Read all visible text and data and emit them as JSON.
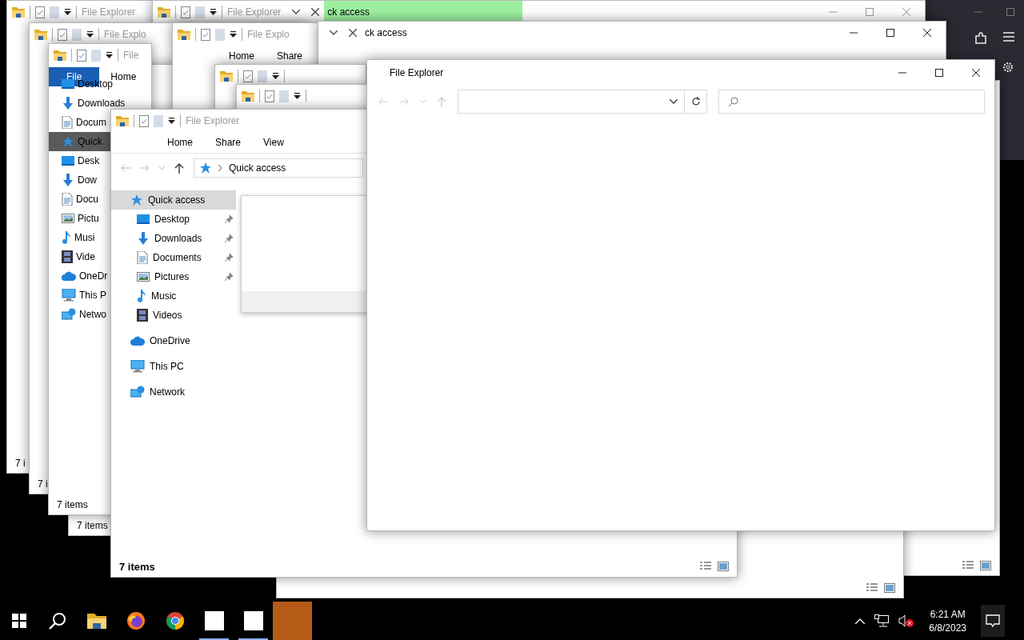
{
  "desktop_windows": [
    {
      "kind": "browser"
    },
    {
      "kind": "explorer",
      "title": "File Explorer",
      "status": "7 i"
    },
    {
      "kind": "blank"
    },
    {
      "kind": "explorer",
      "title": "File Explorer",
      "tab_label": "ck access",
      "highlighted": true
    },
    {
      "kind": "explorer",
      "title": "File Explo",
      "status": "7 i"
    },
    {
      "kind": "blank"
    },
    {
      "kind": "frame",
      "status": "7 items"
    },
    {
      "kind": "explorer",
      "title": "File Explo",
      "ribbon": [
        {
          "label": "Home",
          "selected": false
        },
        {
          "label": "Share",
          "selected": false
        }
      ]
    },
    {
      "kind": "tab",
      "tab_label": "ck access",
      "highlighted": false
    },
    {
      "kind": "explorer",
      "title": "File",
      "ribbon": [
        {
          "label": "File",
          "selected": true
        },
        {
          "label": "Home",
          "selected": false
        }
      ],
      "nav": [
        {
          "kind": "desktop",
          "label": "Desktop",
          "selected": false
        },
        {
          "kind": "downloads",
          "label": "Downloads",
          "selected": false
        },
        {
          "kind": "documents",
          "label": "Docum",
          "selected": false
        },
        {
          "kind": "quick",
          "label": "Quick",
          "selected": true
        },
        {
          "kind": "desktop",
          "label": "Desk",
          "selected": false
        },
        {
          "kind": "downloads",
          "label": "Dow",
          "selected": false
        },
        {
          "kind": "documents",
          "label": "Docu",
          "selected": false
        },
        {
          "kind": "pictures",
          "label": "Pictu",
          "selected": false
        },
        {
          "kind": "music",
          "label": "Musi",
          "selected": false
        },
        {
          "kind": "videos",
          "label": "Vide",
          "selected": false
        },
        {
          "kind": "onedrive",
          "label": "OneDr",
          "selected": false
        },
        {
          "kind": "pc",
          "label": "This P",
          "selected": false
        },
        {
          "kind": "network",
          "label": "Netwo",
          "selected": false
        }
      ],
      "status": "7 items"
    },
    {
      "kind": "explorer"
    },
    {
      "kind": "explorer"
    }
  ],
  "explorer": {
    "title": "File Explorer",
    "ribbon": [
      {
        "label": "Home",
        "selected": false
      },
      {
        "label": "Share",
        "selected": false
      },
      {
        "label": "View",
        "selected": false
      }
    ],
    "address": "Quick access",
    "nav": [
      {
        "kind": "quick",
        "label": "Quick access",
        "selected": true,
        "children": [
          {
            "kind": "desktop",
            "label": "Desktop",
            "pinned": true,
            "selected": false
          },
          {
            "kind": "downloads",
            "label": "Downloads",
            "pinned": true,
            "selected": false
          },
          {
            "kind": "documents",
            "label": "Documents",
            "pinned": true,
            "selected": false
          },
          {
            "kind": "pictures",
            "label": "Pictures",
            "pinned": true,
            "selected": false
          },
          {
            "kind": "music",
            "label": "Music",
            "pinned": false,
            "selected": false
          },
          {
            "kind": "videos",
            "label": "Videos",
            "pinned": false,
            "selected": false
          }
        ]
      },
      {
        "kind": "onedrive",
        "label": "OneDrive",
        "selected": false
      },
      {
        "kind": "pc",
        "label": "This PC",
        "selected": false
      },
      {
        "kind": "network",
        "label": "Network",
        "selected": false
      }
    ],
    "status": "7 items"
  },
  "front_window": {
    "title": "File Explorer"
  },
  "taskbar": {
    "apps": [
      {
        "kind": "explorer",
        "running": false,
        "flashing": false
      },
      {
        "kind": "firefox",
        "running": false,
        "flashing": false
      },
      {
        "kind": "chrome",
        "running": false,
        "flashing": false
      },
      {
        "kind": "blank",
        "running": true,
        "flashing": false
      },
      {
        "kind": "blank",
        "running": true,
        "flashing": false
      },
      {
        "kind": "tile",
        "running": false,
        "flashing": true
      }
    ],
    "time": "6:21 AM",
    "date": "6/8/2023"
  }
}
